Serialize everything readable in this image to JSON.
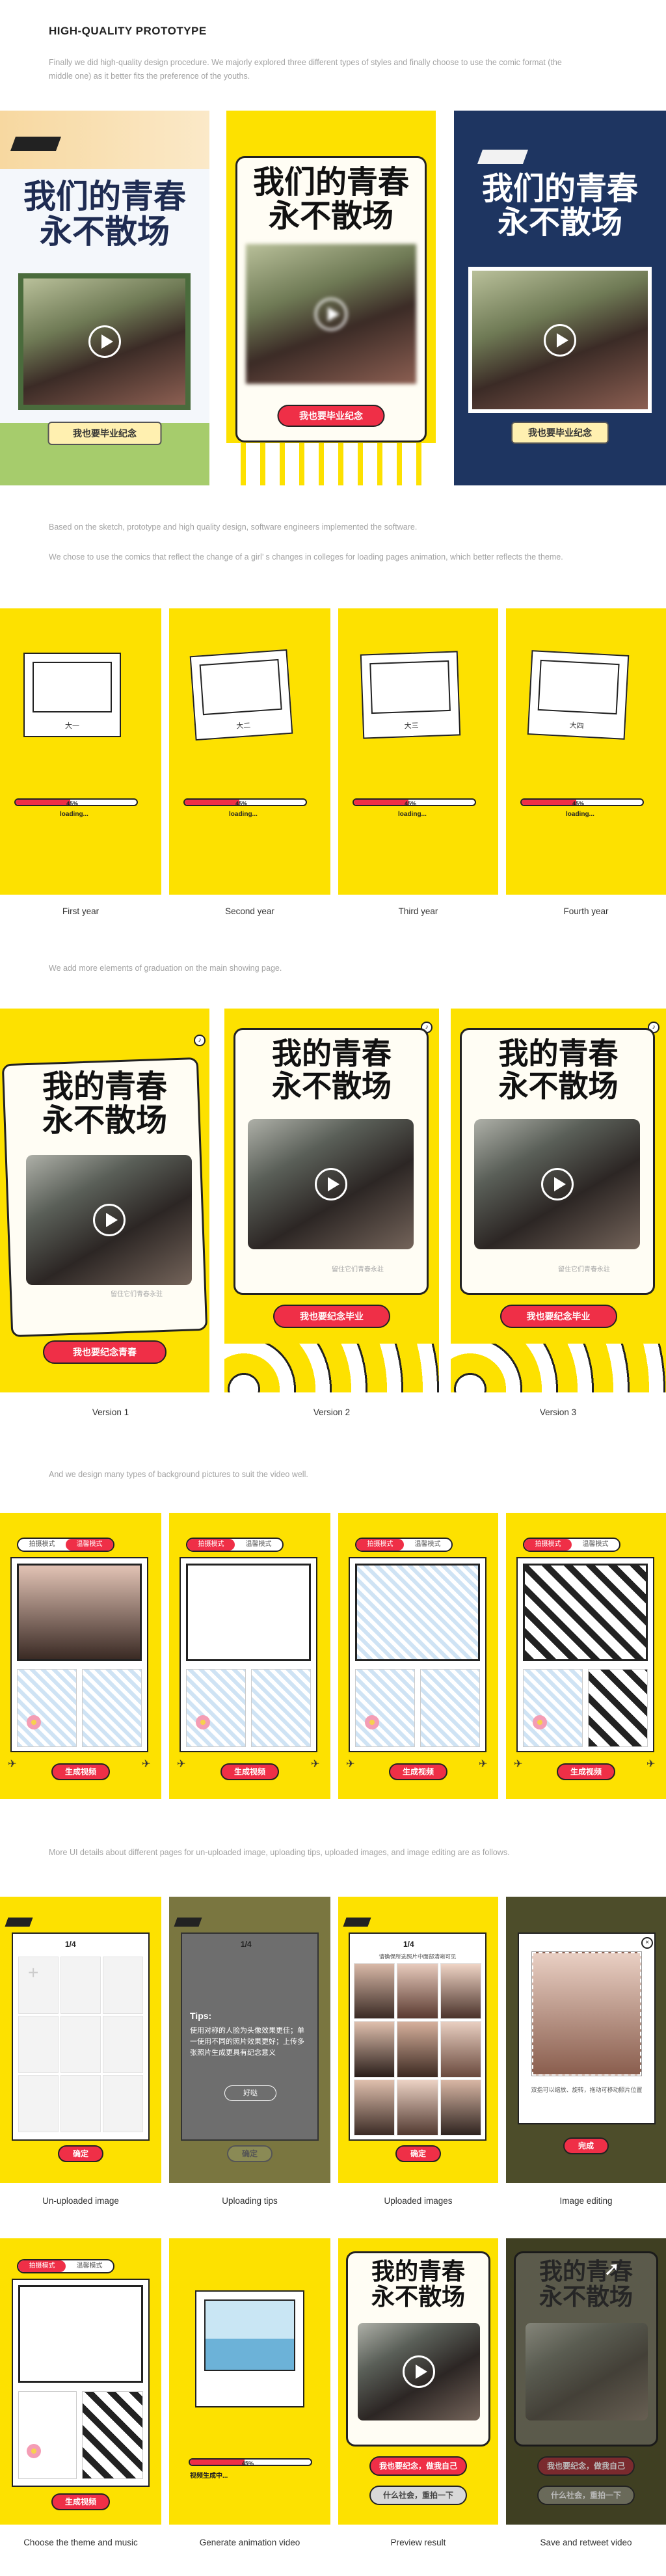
{
  "heading": "HIGH-QUALITY PROTOTYPE",
  "intro": "Finally we did high-quality design procedure. We majorly explored three different types of styles and finally choose to use the comic format (the middle one) as it better fits the preference of the youths.",
  "section2_p1": "Based on the sketch, prototype and high quality design, software engineers implemented the software.",
  "section2_p2": "We chose to use the comics that reflect the change of a girl’ s changes in colleges for loading pages animation, which better reflects the theme.",
  "section3": "We add more elements of graduation on the main showing page.",
  "section4": "And we design many types of background pictures to suit the video well.",
  "section5": "More UI details about different pages for un-uploaded image, uploading tips, uploaded images, and image editing are as follows.",
  "title_text": "我们的青春\n永不散场",
  "title_text_alt": "我的青春\n永不散场",
  "cover_buttons": [
    "我也要毕业纪念",
    "我也要毕业纪念",
    "我也要毕业纪念"
  ],
  "loading": {
    "percent_label": "45%",
    "progress": 0.45,
    "loading_label": "loading...",
    "tags": [
      "大一",
      "大二",
      "大三",
      "大四"
    ],
    "captions": [
      "First year",
      "Second year",
      "Third year",
      "Fourth year"
    ]
  },
  "versions": {
    "buttons": [
      "我也要纪念青春",
      "我也要纪念毕业",
      "我也要纪念毕业"
    ],
    "signature": "留住它们青春永驻",
    "captions": [
      "Version 1",
      "Version 2",
      "Version 3"
    ]
  },
  "templates": {
    "mode_a": "拍摄模式",
    "mode_b": "温馨模式",
    "generate": "生成视频"
  },
  "details": {
    "pager": "1/4",
    "confirm": "确定",
    "finish": "完成",
    "tips_title": "Tips:",
    "tips_body": "使用对称的人脸为头像效果更佳；单一使用不同的照片效果更好；上传多张照片生成更具有纪念意义",
    "got_it": "好哒",
    "uploaded_hint": "请确保所选照片中面部清晰可见",
    "editing_hint": "双指可以缩放、旋转，拖动可移动照片位置",
    "captions": [
      "Un-uploaded image",
      "Uploading tips",
      "Uploaded images",
      "Image editing"
    ]
  },
  "final": {
    "generating": "视频生成中...",
    "percent_label": "45%",
    "progress": 0.45,
    "preview_btn1": "我也要纪念，做我自己",
    "preview_btn2": "什么社会，重拍一下",
    "captions": [
      "Choose the theme and music",
      "Generate animation video",
      "Preview result",
      "Save and retweet video"
    ]
  },
  "colors": {
    "yellow": "#fde100",
    "red": "#ef2f47",
    "navy": "#1e3561",
    "olive": "#8a8a55"
  }
}
